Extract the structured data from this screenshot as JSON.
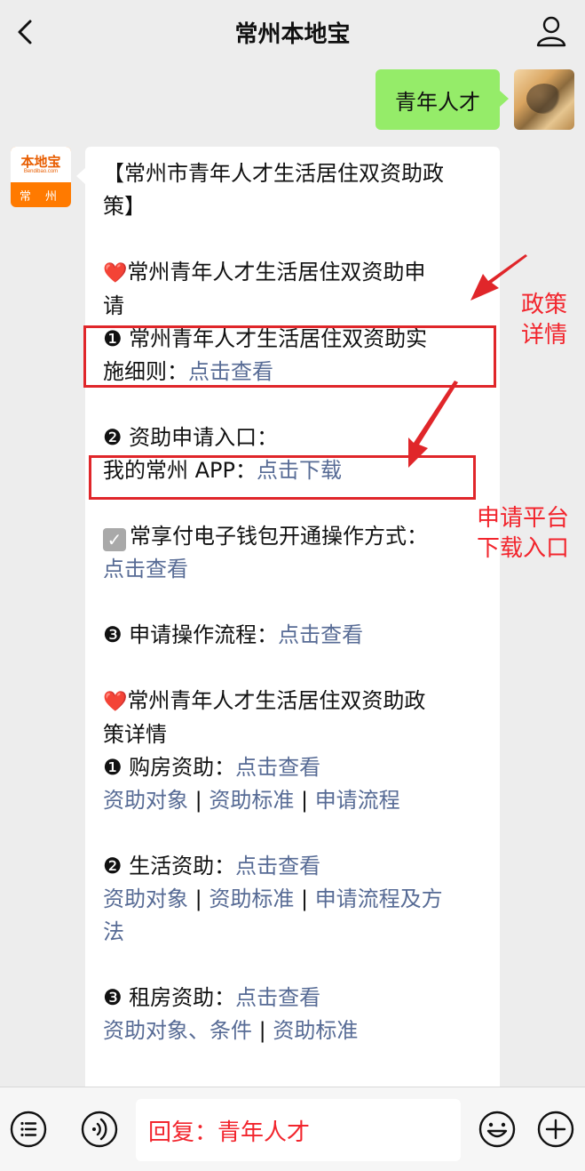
{
  "header": {
    "title": "常州本地宝"
  },
  "outgoing": {
    "text": "青年人才"
  },
  "account_avatar": {
    "logo": "本地宝",
    "sub": "Bendibao.com",
    "city": "常 州"
  },
  "message": {
    "title_l1": "【常州市青年人才生活居住双资助政",
    "title_l2": "策】",
    "s1_heading_l1": "常州青年人才生活居住双资助申",
    "s1_heading_l2": "请",
    "item1_l1": "❶ 常州青年人才生活居住双资助实",
    "item1_l2": "施细则：",
    "item1_link": "点击查看",
    "item2_label": "❷ 资助申请入口：",
    "app_label": "我的常州 APP：",
    "app_link": "点击下载",
    "wallet_label": "常享付电子钱包开通操作方式：",
    "wallet_link": "点击查看",
    "item3_label": "❸ 申请操作流程：",
    "item3_link": "点击查看",
    "s2_heading_l1": "常州青年人才生活居住双资助政",
    "s2_heading_l2": "策详情",
    "housing_label": "❶ 购房资助：",
    "housing_link": "点击查看",
    "housing_sub": [
      "资助对象",
      "资助标准",
      "申请流程"
    ],
    "living_label": "❷ 生活资助：",
    "living_link": "点击查看",
    "living_sub_l1": [
      "资助对象",
      "资助标准",
      "申请流程及方"
    ],
    "living_sub_l2": "法",
    "rent_label": "❸ 租房资助：",
    "rent_link": "点击查看",
    "rent_sub": [
      "资助对象、条件",
      "资助标准"
    ],
    "separator": " | "
  },
  "annotations": {
    "policy_l1": "政策",
    "policy_l2": "详情",
    "platform_l1": "申请平台",
    "platform_l2": "下载入口"
  },
  "bottom_bar": {
    "reply_text": "回复：青年人才"
  },
  "colors": {
    "link": "#576b95",
    "annotation_red": "#e0262a",
    "green_bubble": "#95ec69"
  }
}
